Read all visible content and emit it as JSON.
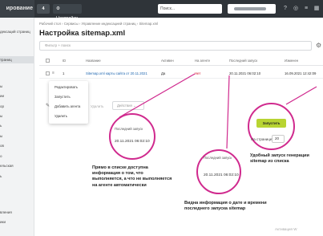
{
  "topbar": {
    "brand": "ирование",
    "count_badge": "4",
    "settings_label": "Настройки",
    "search_placeholder": "Поиск..."
  },
  "sidebar": {
    "items": [
      "дексаций страниц",
      "траниц",
      "ы",
      "ии",
      "ор",
      "ы",
      "ь",
      "ы",
      "ов",
      "о",
      "ельская",
      "ь",
      "вления",
      "ики"
    ]
  },
  "breadcrumbs": [
    "Рабочий стол",
    "Сервисы",
    "Управление индексацией страниц",
    "Sitemap.xml"
  ],
  "page": {
    "title": "Настройка sitemap.xml",
    "filter_placeholder": "Фильтр + поиск"
  },
  "table": {
    "headers": [
      "ID",
      "Название",
      "Активен",
      "На агенте",
      "Последний запуск",
      "Изменен"
    ],
    "rows": [
      {
        "id": "1",
        "name": "Sitemap.xml карты сайта от 20.11.2021",
        "active": "Да",
        "agent": "Нет",
        "last_run": "20.11.2021 06:02:10",
        "modified": "16.09.2021 12:42:09"
      }
    ]
  },
  "context_menu": {
    "items": [
      "Редактировать",
      "Запустить",
      "Добавить агента",
      "Удалить"
    ]
  },
  "group_action": {
    "label": "Удалить",
    "select": "Действия"
  },
  "callouts": {
    "left": {
      "label": "Последний запуск",
      "value": "20.11.2021 06:02:10"
    },
    "bottom": {
      "label": "Последний запуск",
      "value": "20.11.2021 06:02:10"
    },
    "right": {
      "button": "Запустить",
      "per_page_label": "На странице:",
      "per_page_value": "20"
    }
  },
  "annotations": {
    "left": "Прямо в списке доступна информация о том, что выполняется, а что не выполняется на агенте автоматически",
    "bottom": "Видна информация о дате и времени последнего запуска sitemap",
    "right": "Удобный запуск генерации sitemap из списка"
  },
  "footer": {
    "activation": "Активация W"
  },
  "colors": {
    "accent": "#d02a8e",
    "run_button": "#b8d432",
    "topbar": "#2f3439"
  }
}
